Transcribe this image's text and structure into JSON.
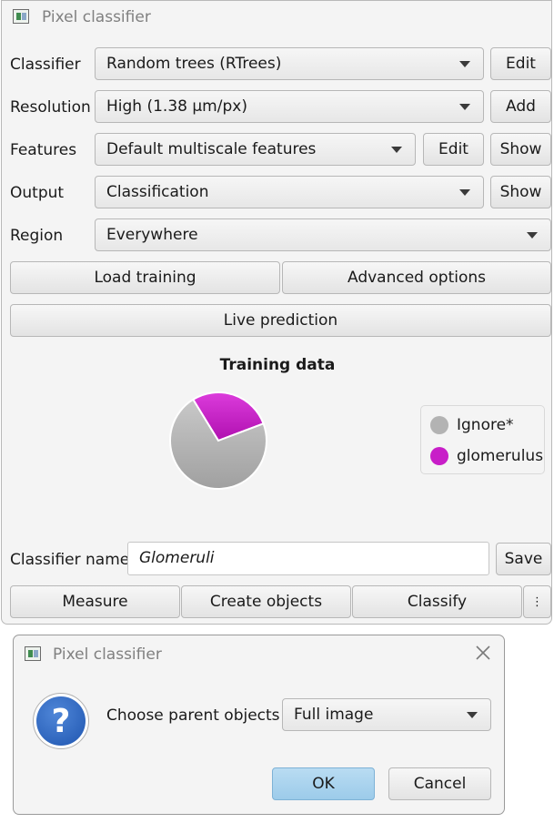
{
  "main_window": {
    "title": "Pixel classifier",
    "rows": {
      "classifier": {
        "label": "Classifier",
        "value": "Random trees (RTrees)",
        "button": "Edit"
      },
      "resolution": {
        "label": "Resolution",
        "value": "High (1.38 µm/px)",
        "button": "Add"
      },
      "features": {
        "label": "Features",
        "value": "Default multiscale features",
        "edit_button": "Edit",
        "show_button": "Show"
      },
      "output": {
        "label": "Output",
        "value": "Classification",
        "button": "Show"
      },
      "region": {
        "label": "Region",
        "value": "Everywhere"
      }
    },
    "buttons": {
      "load_training": "Load training",
      "advanced_options": "Advanced options",
      "live_prediction": "Live prediction"
    },
    "chart": {
      "title": "Training data",
      "legend": [
        {
          "name": "Ignore*",
          "color": "#b3b3b3"
        },
        {
          "name": "glomerulus",
          "color": "#c81ec8"
        }
      ]
    },
    "classifier_name": {
      "label": "Classifier name",
      "value": "Glomeruli",
      "save": "Save"
    },
    "actions": {
      "measure": "Measure",
      "create_objects": "Create objects",
      "classify": "Classify",
      "more": "⋮"
    }
  },
  "chart_data": {
    "type": "pie",
    "title": "Training data",
    "categories": [
      "Ignore*",
      "glomerulus"
    ],
    "values": [
      72,
      28
    ],
    "colors": [
      "#b3b3b3",
      "#c81ec8"
    ],
    "legend_position": "right"
  },
  "dialog": {
    "title": "Pixel classifier",
    "prompt": "Choose parent objects",
    "selected": "Full image",
    "ok": "OK",
    "cancel": "Cancel"
  }
}
